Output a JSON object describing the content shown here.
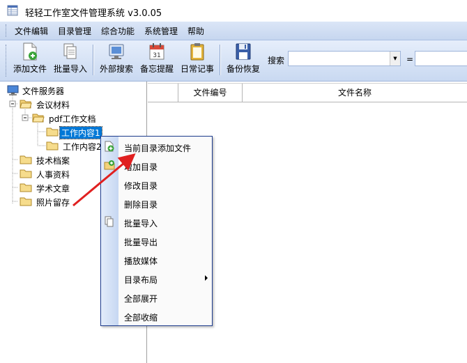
{
  "window": {
    "title": "轻轻工作室文件管理系统 v3.0.05",
    "icon": "spreadsheet-icon"
  },
  "menubar": {
    "items": [
      "文件编辑",
      "目录管理",
      "综合功能",
      "系统管理",
      "帮助"
    ]
  },
  "toolbar": {
    "buttons": [
      {
        "label": "添加文件",
        "icon": "add-file-icon"
      },
      {
        "label": "批量导入",
        "icon": "batch-import-icon"
      },
      {
        "label": "外部搜索",
        "icon": "external-search-icon"
      },
      {
        "label": "备忘提醒",
        "icon": "calendar-icon"
      },
      {
        "label": "日常记事",
        "icon": "clipboard-icon"
      },
      {
        "label": "备份恢复",
        "icon": "floppy-disk-icon"
      }
    ],
    "search_label": "搜索",
    "equals_label": "="
  },
  "tree": {
    "root": "文件服务器",
    "nodes": {
      "meeting": "会议材料",
      "pdf_docs": "pdf工作文档",
      "work1": "工作内容1",
      "work2": "工作内容2",
      "tech": "技术档案",
      "hr": "人事资料",
      "academic": "学术文章",
      "photos": "照片留存"
    },
    "selected": "工作内容1"
  },
  "grid": {
    "columns": [
      "",
      "文件编号",
      "文件名称"
    ]
  },
  "context_menu": {
    "items": [
      {
        "label": "当前目录添加文件",
        "icon": "add-file-icon"
      },
      {
        "label": "增加目录",
        "icon": "add-folder-icon"
      },
      {
        "label": "修改目录",
        "icon": ""
      },
      {
        "label": "删除目录",
        "icon": ""
      },
      {
        "label": "批量导入",
        "icon": "batch-import-icon"
      },
      {
        "label": "批量导出",
        "icon": ""
      },
      {
        "label": "播放媒体",
        "icon": ""
      },
      {
        "label": "目录布局",
        "icon": "",
        "submenu": true
      },
      {
        "label": "全部展开",
        "icon": ""
      },
      {
        "label": "全部收缩",
        "icon": ""
      }
    ]
  },
  "colors": {
    "menubar": "#c6d6ef",
    "toolbar": "#c9d9f1",
    "selection": "#0078d7",
    "context_border": "#1c3a8c",
    "annotation_arrow": "#e02020"
  }
}
